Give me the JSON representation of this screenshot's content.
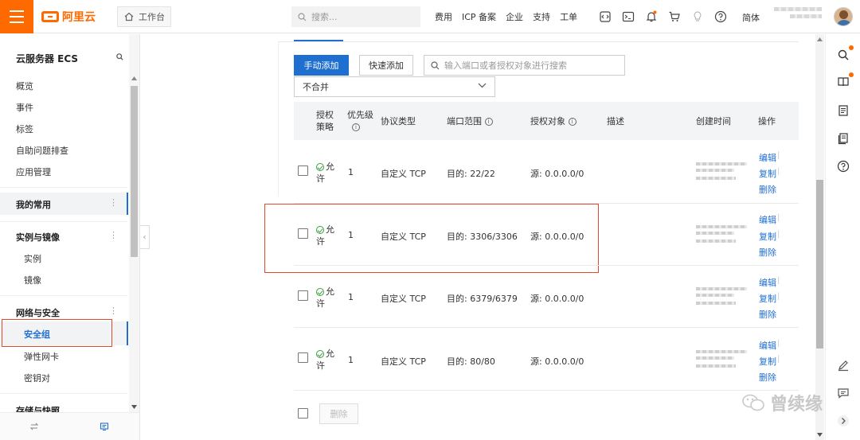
{
  "topbar": {
    "brand": "阿里云",
    "workbench": "工作台",
    "search_placeholder": "搜索...",
    "links": [
      "费用",
      "ICP 备案",
      "企业",
      "支持",
      "工单"
    ],
    "lang": "简体",
    "accent": "#ff6a00"
  },
  "sidebar": {
    "title": "云服务器 ECS",
    "items": [
      "概览",
      "事件",
      "标签",
      "自助问题排查",
      "应用管理"
    ],
    "favorites": "我的常用",
    "group_instances": "实例与镜像",
    "instances_items": [
      "实例",
      "镜像"
    ],
    "group_network": "网络与安全",
    "network_items": [
      "安全组",
      "弹性网卡",
      "密钥对"
    ],
    "group_storage": "存储与快照"
  },
  "toolbar": {
    "manual_add": "手动添加",
    "quick_add": "快速添加",
    "search_placeholder": "输入端口或者授权对象进行搜索",
    "merge_select": "不合并"
  },
  "table": {
    "headers": {
      "policy": "授权策略",
      "priority": "优先级",
      "protocol": "协议类型",
      "port": "端口范围",
      "object": "授权对象",
      "desc": "描述",
      "created": "创建时间",
      "ops": "操作"
    },
    "rows": [
      {
        "policy": "允许",
        "priority": "1",
        "protocol": "自定义 TCP",
        "port": "目的: 22/22",
        "object": "源: 0.0.0.0/0"
      },
      {
        "policy": "允许",
        "priority": "1",
        "protocol": "自定义 TCP",
        "port": "目的: 3306/3306",
        "object": "源: 0.0.0.0/0"
      },
      {
        "policy": "允许",
        "priority": "1",
        "protocol": "自定义 TCP",
        "port": "目的: 6379/6379",
        "object": "源: 0.0.0.0/0"
      },
      {
        "policy": "允许",
        "priority": "1",
        "protocol": "自定义 TCP",
        "port": "目的: 80/80",
        "object": "源: 0.0.0.0/0"
      }
    ],
    "ops": {
      "edit": "编辑",
      "copy": "复制",
      "delete": "删除"
    },
    "bulk_delete": "删除"
  },
  "watermark": "曾续缘",
  "colors": {
    "primary": "#1f6fd1",
    "highlight": "#e04a2e",
    "success": "#3aa03a"
  }
}
